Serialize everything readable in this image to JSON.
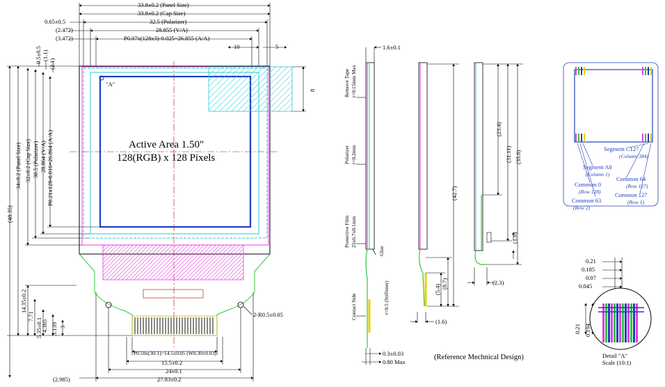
{
  "top_dims": {
    "panel": "33.8±0.2 (Panel Size)",
    "cap": "33.8±0.2 (Cap Size)",
    "left_offset": "0.65±0.5",
    "polarizer": "32.5 (Polarizer)",
    "va_offset": "(2.472)",
    "va": "28.855 (V/A)",
    "aa_offset": "(3.472)",
    "aa": "P0.07x(128x3)-0.025=26.855 (A/A)",
    "ten": "10",
    "five": "5"
  },
  "left_dims": {
    "top_gap": "0.5±0.5",
    "v11": "(1.1)",
    "v21": "(2.1)",
    "overall": "(48.35)",
    "panel": "34±0.2 (Panel Size)",
    "cap": "32±0.2 (Cap Size)",
    "polarizer": "30.5 (Polarizer)",
    "va": "28.864 (V/A)",
    "aa": "P0.21x128-0.016=26.864 (A/A)",
    "fpc": "14.35±0.2",
    "v771": "7.71",
    "v4365": "4.365",
    "v535": "5.35±0.1",
    "v3139": "3.139",
    "v3": "3",
    "eight": "8"
  },
  "center": {
    "active_area": "Active Area 1.50\"",
    "pixels": "128(RGB) x 128 Pixels",
    "marker": "\"A\""
  },
  "bottom_dims": {
    "pitch": "P0.50x(30-1)=14.5±0.05 (W0.30±0.03)",
    "d155": "15.5±0.2",
    "d24": "24±0.1",
    "d2783": "27.83±0.2",
    "d2985": "(2.985)",
    "hole": "2-R0.5±0.05"
  },
  "side_view": {
    "thickness": "1.6±0.1",
    "remove_tape": "Remove Tape",
    "remove_tape_thk": "t=0.15mm Max",
    "polarizer": "Polarizer",
    "polarizer_thk": "t=0.2mm",
    "film": "Protective Film",
    "film_size": "25x6.7x0.1mm",
    "glue": "Glue",
    "contact": "Contact Side",
    "stiffener": "t=0.5 (Stiffener)",
    "d03": "0.3±0.03",
    "d08": "0.80 Max"
  },
  "mid_view": {
    "d427": "(42.7)",
    "d54": "(5.4)",
    "d87": "(8.7)",
    "d16": "(1.6)"
  },
  "right_view": {
    "d234": "(23.4)",
    "d3111": "(31.11)",
    "d356": "(35.6)",
    "d16": "(1.6)",
    "d23": "(2.3)"
  },
  "reference": "(Reference Mechnical Design)",
  "pin_map": {
    "seg127": "Segment C127",
    "col384": "(Column 384)",
    "seg0": "Segment A0",
    "col1": "(Column 1)",
    "com0": "Common 0",
    "row128": "(Row 128)",
    "com63": "Common 63",
    "row2": "(Row 2)",
    "com64": "Common 64",
    "row127": "(Row 127)",
    "com127": "Common 127",
    "row1": "(Row 1)"
  },
  "detail": {
    "d021": "0.21",
    "d0185": "0.185",
    "d007": "0.07",
    "d0045": "0.045",
    "v021": "0.21",
    "v0194": "0.194",
    "title": "Detail \"A\"",
    "scale": "Scale (10:1)"
  }
}
